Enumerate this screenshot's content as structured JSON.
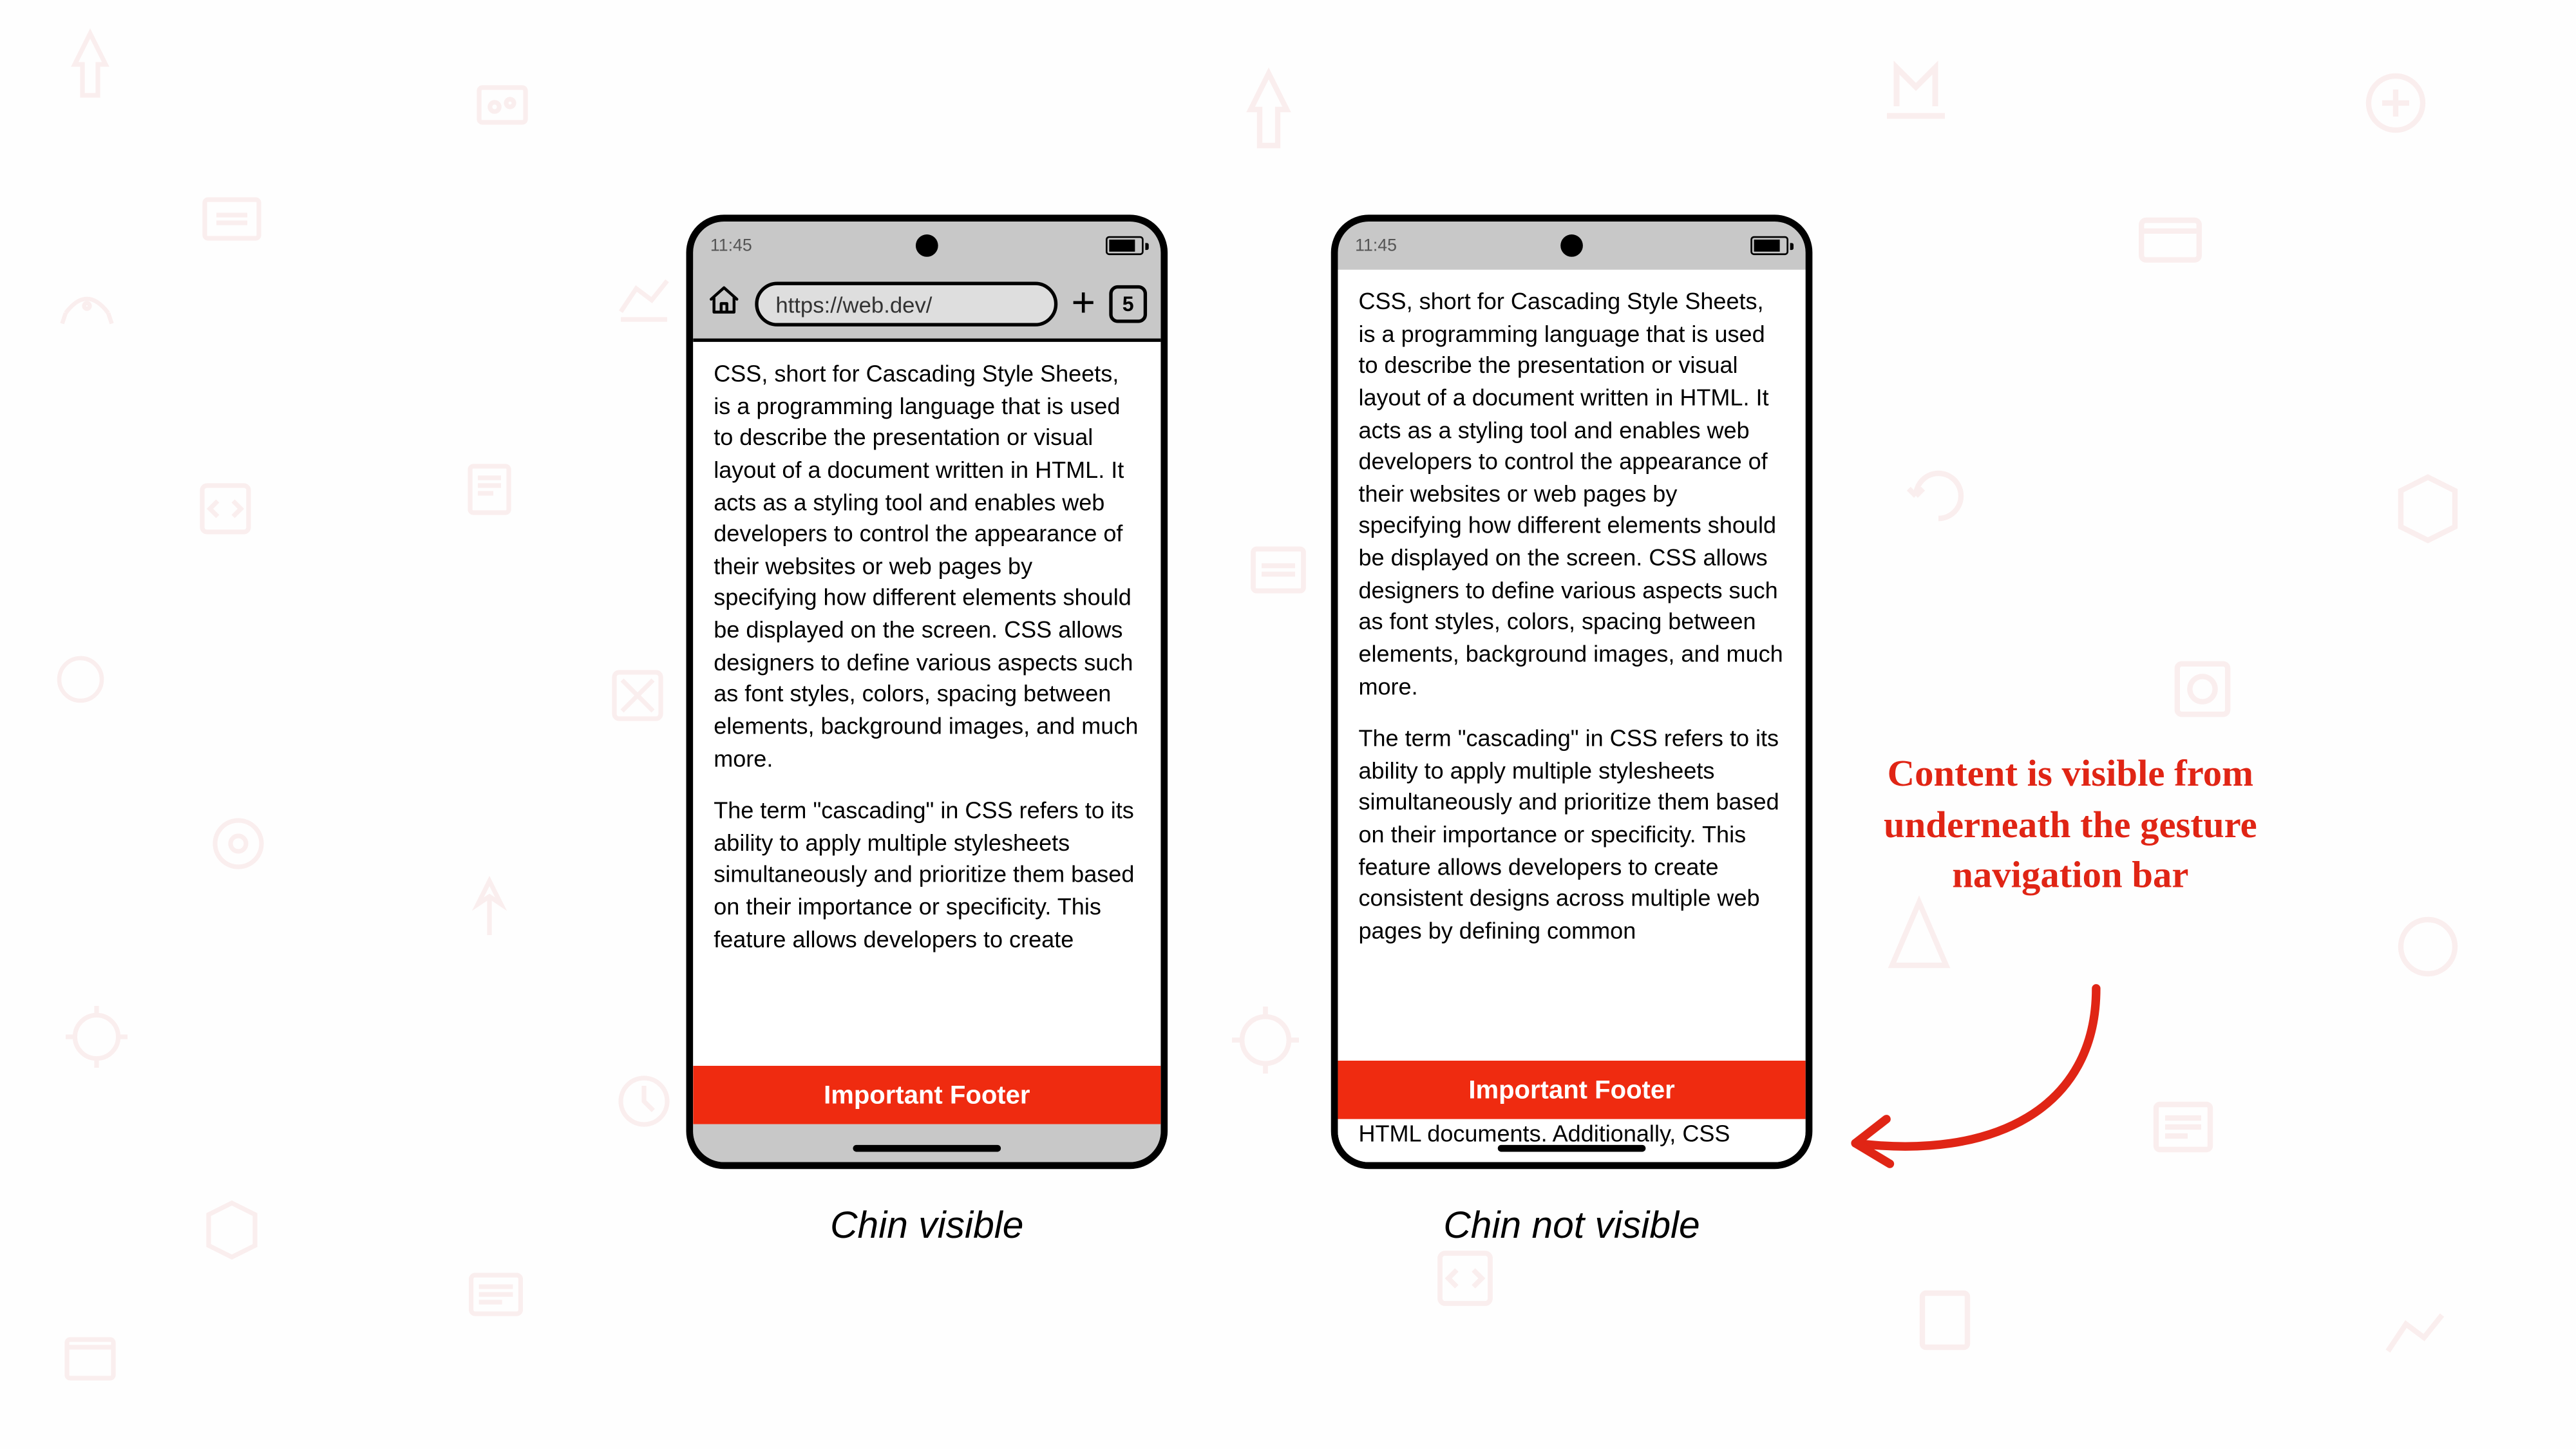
{
  "status": {
    "time": "11:45"
  },
  "browser": {
    "url": "https://web.dev/",
    "tab_count": "5"
  },
  "content": {
    "para1": "CSS, short for Cascading Style Sheets, is a programming language that is used to describe the presentation or visual layout of a document written in HTML. It acts as a styling tool and enables web developers to control the appearance of their websites or web pages by specifying how different elements should be displayed on the screen. CSS allows designers to define various aspects such as font styles, colors, spacing between elements, background images, and much more.",
    "para2_short": "The term \"cascading\" in CSS refers to its ability to apply multiple stylesheets simultaneously and prioritize them based on their importance or specificity. This feature allows developers to create",
    "para2_long": "The term \"cascading\" in CSS refers to its ability to apply multiple stylesheets simultaneously and prioritize them based on their importance or specificity. This feature allows developers to create consistent designs across multiple web pages by defining common",
    "underspill": "HTML documents. Additionally, CSS"
  },
  "footer": {
    "label": "Important Footer"
  },
  "captions": {
    "left": "Chin visible",
    "right": "Chin not visible"
  },
  "annotation": {
    "text": "Content is visible from underneath the gesture navigation bar"
  }
}
